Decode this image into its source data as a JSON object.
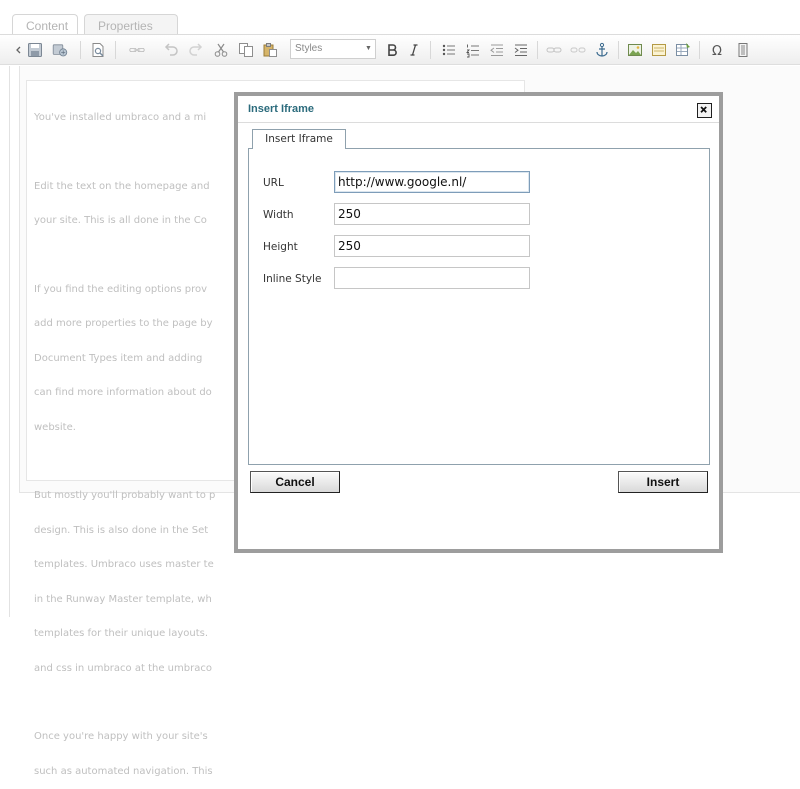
{
  "tabs": [
    {
      "label": "Content"
    },
    {
      "label": "Properties"
    }
  ],
  "toolbar": {
    "styles_select": "Styles",
    "icons": [
      "collapse-arrow-icon",
      "save-icon",
      "save-publish-icon",
      "preview-icon",
      "link-icon",
      "undo-icon",
      "redo-icon",
      "cut-icon",
      "copy-icon",
      "paste-icon",
      "bold-icon",
      "italic-icon",
      "bullet-list-icon",
      "numbered-list-icon",
      "outdent-icon",
      "indent-icon",
      "insert-link-icon",
      "unlink-icon",
      "anchor-icon",
      "insert-image-icon",
      "insert-macro-icon",
      "insert-table-icon",
      "character-map-icon",
      "html-source-icon"
    ]
  },
  "editor": {
    "lines": [
      "You've installed umbraco and a mi",
      "",
      "Edit the text on the homepage and",
      "your site. This is all done in the Co",
      "",
      "If you find the editing options prov",
      "add more properties to the page by",
      "Document Types item and adding",
      "can find more information about do",
      "website.",
      "",
      "But mostly you'll probably want to p",
      "design. This is also done in the Set",
      "templates. Umbraco uses master te",
      "in the Runway Master template, wh",
      "templates for their unique layouts.",
      "and css in umbraco at the umbraco",
      "",
      "Once you're happy with your site's",
      "such as automated navigation. This"
    ]
  },
  "dialog": {
    "title": "Insert Iframe",
    "tab_label": "Insert Iframe",
    "fields": {
      "url": {
        "label": "URL",
        "value": "http://www.google.nl/"
      },
      "width": {
        "label": "Width",
        "value": "250"
      },
      "height": {
        "label": "Height",
        "value": "250"
      },
      "inline_style": {
        "label": "Inline Style",
        "value": ""
      }
    },
    "cancel_label": "Cancel",
    "insert_label": "Insert"
  }
}
